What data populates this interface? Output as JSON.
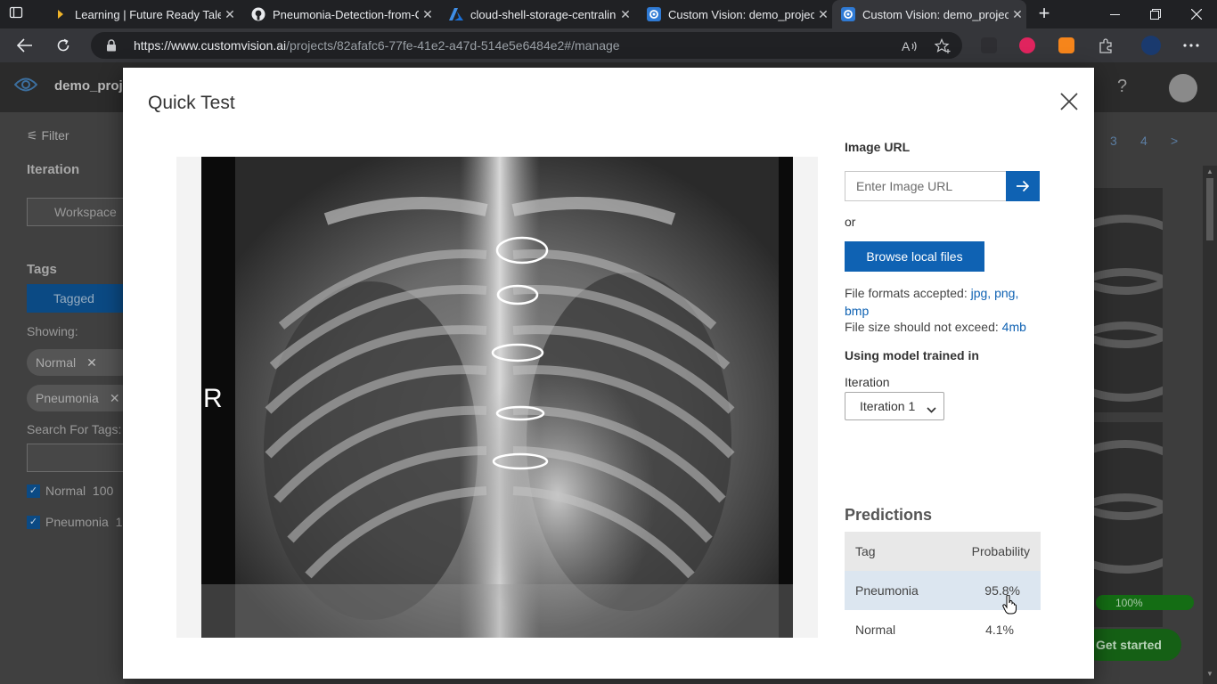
{
  "browser": {
    "tabs": [
      {
        "title": "Learning | Future Ready Talen",
        "icon": "learning-icon",
        "active": false
      },
      {
        "title": "Pneumonia-Detection-from-C",
        "icon": "github-icon",
        "active": false
      },
      {
        "title": "cloud-shell-storage-centralin",
        "icon": "azure-icon",
        "active": false
      },
      {
        "title": "Custom Vision: demo_project",
        "icon": "custom-vision-icon",
        "active": false
      },
      {
        "title": "Custom Vision: demo_project",
        "icon": "custom-vision-icon",
        "active": true
      }
    ],
    "url_host": "https://www.customvision.ai",
    "url_path": "/projects/82afafc6-77fe-41e2-a47d-514e5e6484e2#/manage"
  },
  "page": {
    "project_name": "demo_proje",
    "filter_label": "Filter",
    "iteration_heading": "Iteration",
    "workspace_label": "Workspace",
    "tags_heading": "Tags",
    "tagged_label": "Tagged",
    "showing_label": "Showing:",
    "chips": [
      "Normal",
      "Pneumonia"
    ],
    "search_label": "Search For Tags:",
    "tag_filters": [
      {
        "label": "Normal",
        "count": "100"
      },
      {
        "label": "Pneumonia",
        "count": "1"
      }
    ],
    "pages": [
      "3",
      "4",
      ">"
    ],
    "progress_percent": 100,
    "progress_text": "100%",
    "get_started_label": "Get started"
  },
  "dialog": {
    "title": "Quick Test",
    "image_url_heading": "Image URL",
    "image_url_placeholder": "Enter Image URL",
    "or_text": "or",
    "browse_label": "Browse local files",
    "formats_prefix": "File formats accepted:",
    "formats_list": "jpg, png, bmp",
    "size_prefix": "File size should not exceed:",
    "size_limit": "4mb",
    "model_heading": "Using model trained in",
    "iteration_label": "Iteration",
    "iteration_selected": "Iteration 1",
    "xray_marker": "R",
    "predictions_heading": "Predictions",
    "predictions": {
      "header": {
        "tag": "Tag",
        "probability": "Probability"
      },
      "rows": [
        {
          "tag": "Pneumonia",
          "probability": "95.8%"
        },
        {
          "tag": "Normal",
          "probability": "4.1%"
        }
      ]
    }
  },
  "colors": {
    "accent": "#0f62b3",
    "selected_row": "#dce6f0",
    "progress_green": "#146d14"
  }
}
